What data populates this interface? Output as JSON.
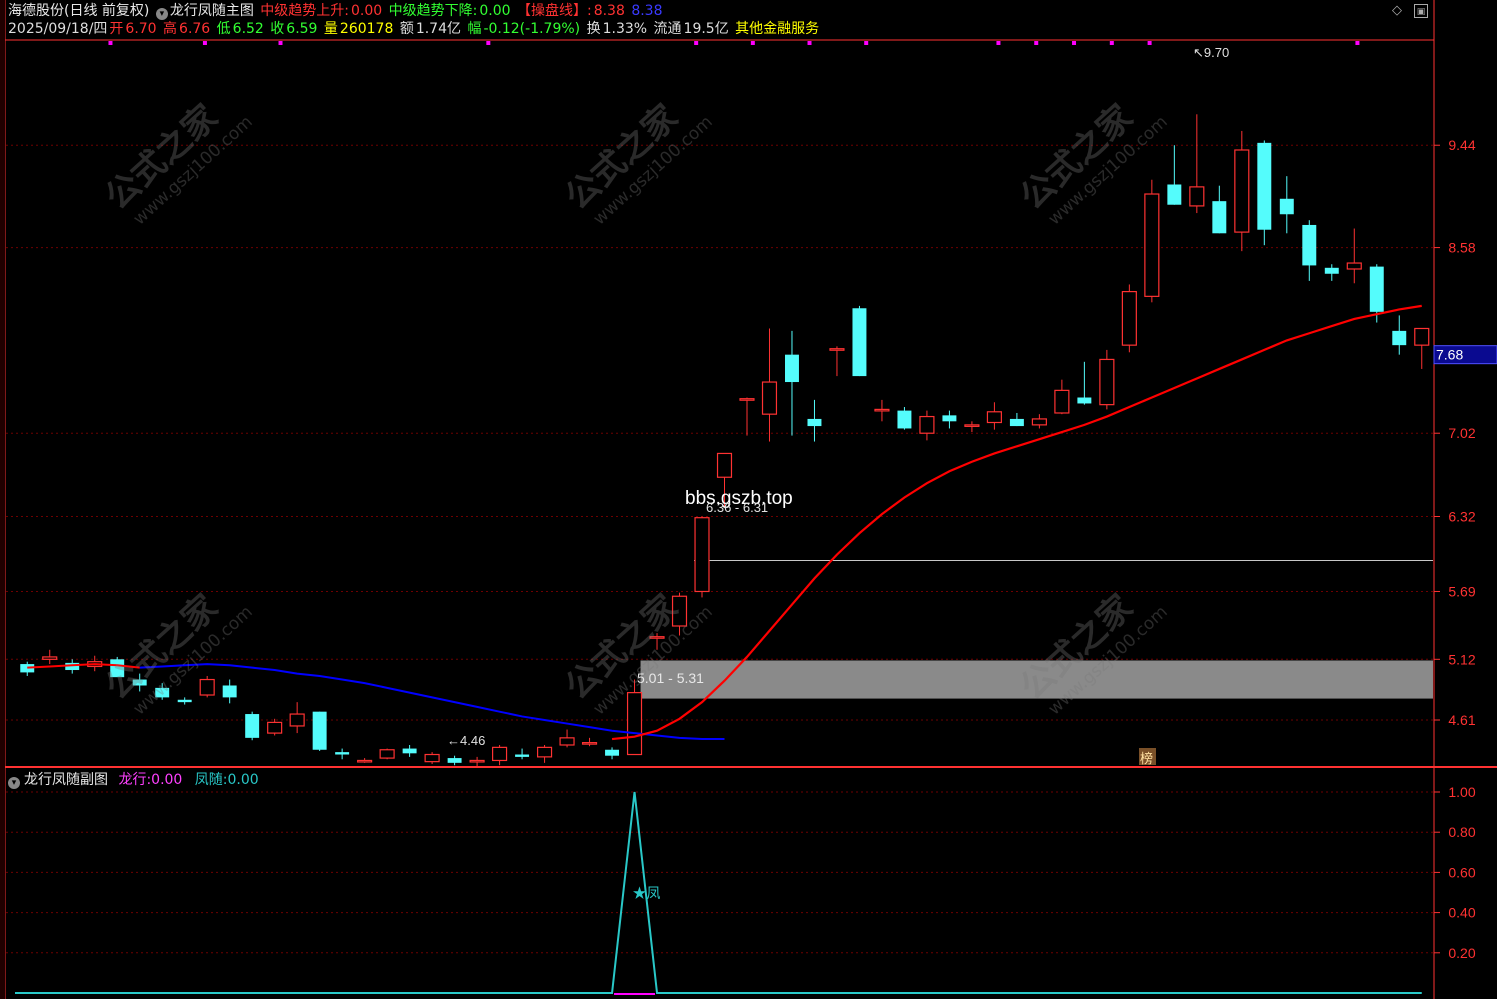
{
  "header": {
    "stock": "海德股份(日线 前复权)",
    "indicator_name": "龙行凤随主图",
    "trend_up_label": "中级趋势上升:",
    "trend_up_value": "0.00",
    "trend_down_label": "中级趋势下降:",
    "trend_down_value": "0.00",
    "pan_label": "【操盘线】:",
    "pan_value": "8.38",
    "pan_value2": "8.38"
  },
  "quote": {
    "date": "2025/09/18/四",
    "open_label": "开",
    "open": "6.70",
    "high_label": "高",
    "high": "6.76",
    "low_label": "低",
    "low": "6.52",
    "close_label": "收",
    "close": "6.59",
    "vol_label": "量",
    "vol": "260178",
    "amount_label": "额",
    "amount": "1.74亿",
    "change_label": "幅",
    "change": "-0.12(-1.79%)",
    "turnover_label": "换",
    "turnover": "1.33%",
    "float_label": "流通",
    "float": "19.5亿",
    "sector": "其他金融服务"
  },
  "sub": {
    "title": "龙行凤随副图",
    "long_label": "龙行:",
    "long_value": "0.00",
    "feng_label": "凤随:",
    "feng_value": "0.00",
    "marker": "凤"
  },
  "watermark": {
    "main": "公式之家",
    "url": "www.gszj100.com"
  },
  "overlay": {
    "site": "bbs.gszb.top",
    "range_low": "5.01 - 5.31",
    "range_high": "6.36 - 6.31",
    "peak": "9.70",
    "trough": "4.46",
    "bang": "榜"
  },
  "colors": {
    "up": "#ff3232",
    "down": "#54fcfc",
    "ma_up": "#ff0000",
    "ma_down": "#0000ff",
    "grid": "#6e0000",
    "axis": "#ff3232",
    "sub_line": "#29c8c8",
    "dot": "#ff00ff"
  },
  "chart_data": [
    {
      "type": "candlestick",
      "title": "龙行凤随主图",
      "ylim": [
        4.3,
        9.9
      ],
      "y_ticks": [
        4.61,
        5.12,
        5.69,
        6.32,
        7.02,
        7.68,
        8.58,
        9.44
      ],
      "last_price_label": "7.68",
      "candles": [
        {
          "o": 5.08,
          "h": 5.1,
          "l": 4.98,
          "c": 5.01
        },
        {
          "o": 5.12,
          "h": 5.2,
          "l": 5.08,
          "c": 5.14
        },
        {
          "o": 5.09,
          "h": 5.12,
          "l": 5.0,
          "c": 5.03
        },
        {
          "o": 5.06,
          "h": 5.15,
          "l": 5.02,
          "c": 5.1
        },
        {
          "o": 5.12,
          "h": 5.14,
          "l": 4.98,
          "c": 4.97
        },
        {
          "o": 4.95,
          "h": 5.0,
          "l": 4.85,
          "c": 4.9
        },
        {
          "o": 4.88,
          "h": 4.92,
          "l": 4.78,
          "c": 4.8
        },
        {
          "o": 4.78,
          "h": 4.8,
          "l": 4.74,
          "c": 4.76
        },
        {
          "o": 4.82,
          "h": 4.98,
          "l": 4.8,
          "c": 4.95
        },
        {
          "o": 4.9,
          "h": 4.95,
          "l": 4.75,
          "c": 4.8
        },
        {
          "o": 4.66,
          "h": 4.68,
          "l": 4.44,
          "c": 4.46
        },
        {
          "o": 4.5,
          "h": 4.62,
          "l": 4.48,
          "c": 4.59
        },
        {
          "o": 4.56,
          "h": 4.76,
          "l": 4.5,
          "c": 4.66
        },
        {
          "o": 4.68,
          "h": 4.68,
          "l": 4.35,
          "c": 4.36
        },
        {
          "o": 4.34,
          "h": 4.37,
          "l": 4.28,
          "c": 4.32
        },
        {
          "o": 4.27,
          "h": 4.29,
          "l": 4.25,
          "c": 4.27
        },
        {
          "o": 4.29,
          "h": 4.37,
          "l": 4.28,
          "c": 4.36
        },
        {
          "o": 4.37,
          "h": 4.4,
          "l": 4.3,
          "c": 4.33
        },
        {
          "o": 4.26,
          "h": 4.34,
          "l": 4.24,
          "c": 4.32
        },
        {
          "o": 4.29,
          "h": 4.31,
          "l": 4.23,
          "c": 4.25
        },
        {
          "o": 4.27,
          "h": 4.3,
          "l": 4.22,
          "c": 4.27
        },
        {
          "o": 4.27,
          "h": 4.4,
          "l": 4.23,
          "c": 4.38
        },
        {
          "o": 4.32,
          "h": 4.37,
          "l": 4.28,
          "c": 4.3
        },
        {
          "o": 4.3,
          "h": 4.4,
          "l": 4.25,
          "c": 4.38
        },
        {
          "o": 4.4,
          "h": 4.53,
          "l": 4.38,
          "c": 4.46
        },
        {
          "o": 4.41,
          "h": 4.46,
          "l": 4.39,
          "c": 4.42
        },
        {
          "o": 4.36,
          "h": 4.38,
          "l": 4.28,
          "c": 4.31
        },
        {
          "o": 4.32,
          "h": 4.95,
          "l": 4.32,
          "c": 4.84
        },
        {
          "o": 5.31,
          "h": 5.34,
          "l": 5.2,
          "c": 5.31
        },
        {
          "o": 5.4,
          "h": 5.68,
          "l": 5.32,
          "c": 5.65
        },
        {
          "o": 5.69,
          "h": 6.32,
          "l": 5.64,
          "c": 6.31
        },
        {
          "o": 6.65,
          "h": 6.85,
          "l": 6.4,
          "c": 6.85
        },
        {
          "o": 7.31,
          "h": 7.32,
          "l": 7.0,
          "c": 7.31
        },
        {
          "o": 7.18,
          "h": 7.9,
          "l": 6.95,
          "c": 7.45
        },
        {
          "o": 7.68,
          "h": 7.88,
          "l": 7.0,
          "c": 7.45
        },
        {
          "o": 7.14,
          "h": 7.3,
          "l": 6.95,
          "c": 7.08
        },
        {
          "o": 7.73,
          "h": 7.75,
          "l": 7.5,
          "c": 7.73
        },
        {
          "o": 8.07,
          "h": 8.09,
          "l": 7.5,
          "c": 7.5
        },
        {
          "o": 7.22,
          "h": 7.3,
          "l": 7.12,
          "c": 7.22
        },
        {
          "o": 7.21,
          "h": 7.24,
          "l": 7.05,
          "c": 7.06
        },
        {
          "o": 7.02,
          "h": 7.21,
          "l": 6.96,
          "c": 7.16
        },
        {
          "o": 7.17,
          "h": 7.21,
          "l": 7.06,
          "c": 7.12
        },
        {
          "o": 7.09,
          "h": 7.12,
          "l": 7.03,
          "c": 7.09
        },
        {
          "o": 7.11,
          "h": 7.28,
          "l": 7.05,
          "c": 7.2
        },
        {
          "o": 7.14,
          "h": 7.19,
          "l": 7.08,
          "c": 7.08
        },
        {
          "o": 7.09,
          "h": 7.18,
          "l": 7.06,
          "c": 7.14
        },
        {
          "o": 7.19,
          "h": 7.47,
          "l": 7.18,
          "c": 7.38
        },
        {
          "o": 7.32,
          "h": 7.62,
          "l": 7.26,
          "c": 7.27
        },
        {
          "o": 7.26,
          "h": 7.72,
          "l": 7.22,
          "c": 7.64
        },
        {
          "o": 7.76,
          "h": 8.27,
          "l": 7.7,
          "c": 8.21
        },
        {
          "o": 8.17,
          "h": 9.15,
          "l": 8.12,
          "c": 9.03
        },
        {
          "o": 9.11,
          "h": 9.44,
          "l": 8.94,
          "c": 8.94
        },
        {
          "o": 8.93,
          "h": 9.7,
          "l": 8.87,
          "c": 9.09
        },
        {
          "o": 8.97,
          "h": 9.1,
          "l": 8.7,
          "c": 8.7
        },
        {
          "o": 8.71,
          "h": 9.56,
          "l": 8.55,
          "c": 9.4
        },
        {
          "o": 9.46,
          "h": 9.48,
          "l": 8.6,
          "c": 8.73
        },
        {
          "o": 8.99,
          "h": 9.18,
          "l": 8.7,
          "c": 8.86
        },
        {
          "o": 8.77,
          "h": 8.81,
          "l": 8.3,
          "c": 8.43
        },
        {
          "o": 8.41,
          "h": 8.44,
          "l": 8.3,
          "c": 8.36
        },
        {
          "o": 8.4,
          "h": 8.74,
          "l": 8.28,
          "c": 8.45
        },
        {
          "o": 8.42,
          "h": 8.44,
          "l": 7.95,
          "c": 8.04
        },
        {
          "o": 7.88,
          "h": 8.01,
          "l": 7.68,
          "c": 7.76
        },
        {
          "o": 7.76,
          "h": 7.9,
          "l": 7.56,
          "c": 7.9
        }
      ],
      "ma": [
        5.05,
        5.06,
        5.07,
        5.08,
        5.07,
        5.05,
        5.03,
        5.0,
        4.98,
        4.95,
        4.92,
        4.88,
        4.84,
        4.8,
        4.76,
        4.72,
        4.68,
        4.64,
        4.61,
        4.58,
        4.55,
        4.52,
        4.5,
        4.48,
        4.46,
        4.45,
        4.45,
        4.47,
        4.52,
        4.62,
        4.76,
        4.94,
        5.14,
        5.36,
        5.58,
        5.8,
        6.0,
        6.18,
        6.34,
        6.48,
        6.6,
        6.7,
        6.78,
        6.85,
        6.91,
        6.97,
        7.03,
        7.09,
        7.16,
        7.24,
        7.32,
        7.4,
        7.48,
        7.56,
        7.64,
        7.72,
        7.8,
        7.86,
        7.92,
        7.98,
        8.02,
        8.06,
        8.09
      ],
      "ma_switch_index": 26,
      "zone": [
        4.79,
        5.11
      ],
      "hline": 5.95,
      "dot_indices": [
        5,
        10,
        14,
        25,
        36,
        39,
        42,
        45,
        52,
        54,
        56,
        58,
        60,
        71
      ]
    },
    {
      "type": "line",
      "title": "龙行凤随副图",
      "ylim": [
        0,
        1.05
      ],
      "y_ticks": [
        0.2,
        0.4,
        0.6,
        0.8,
        1.0
      ],
      "series": [
        {
          "name": "凤随",
          "values": [
            0,
            0,
            0,
            0,
            0,
            0,
            0,
            0,
            0,
            0,
            0,
            0,
            0,
            0,
            0,
            0,
            0,
            0,
            0,
            0,
            0,
            0,
            0,
            0,
            0,
            0,
            0,
            1,
            0,
            0,
            0,
            0,
            0,
            0,
            0,
            0,
            0,
            0,
            0,
            0,
            0,
            0,
            0,
            0,
            0,
            0,
            0,
            0,
            0,
            0,
            0,
            0,
            0,
            0,
            0,
            0,
            0,
            0,
            0,
            0,
            0,
            0,
            0
          ]
        },
        {
          "name": "龙行",
          "values": [
            0,
            0,
            0,
            0,
            0,
            0,
            0,
            0,
            0,
            0,
            0,
            0,
            0,
            0,
            0,
            0,
            0,
            0,
            0,
            0,
            0,
            0,
            0,
            0,
            0,
            0,
            0,
            0,
            0,
            0,
            0,
            0,
            0,
            0,
            0,
            0,
            0,
            0,
            0,
            0,
            0,
            0,
            0,
            0,
            0,
            0,
            0,
            0,
            0,
            0,
            0,
            0,
            0,
            0,
            0,
            0,
            0,
            0,
            0,
            0,
            0,
            0,
            0
          ]
        }
      ]
    }
  ]
}
